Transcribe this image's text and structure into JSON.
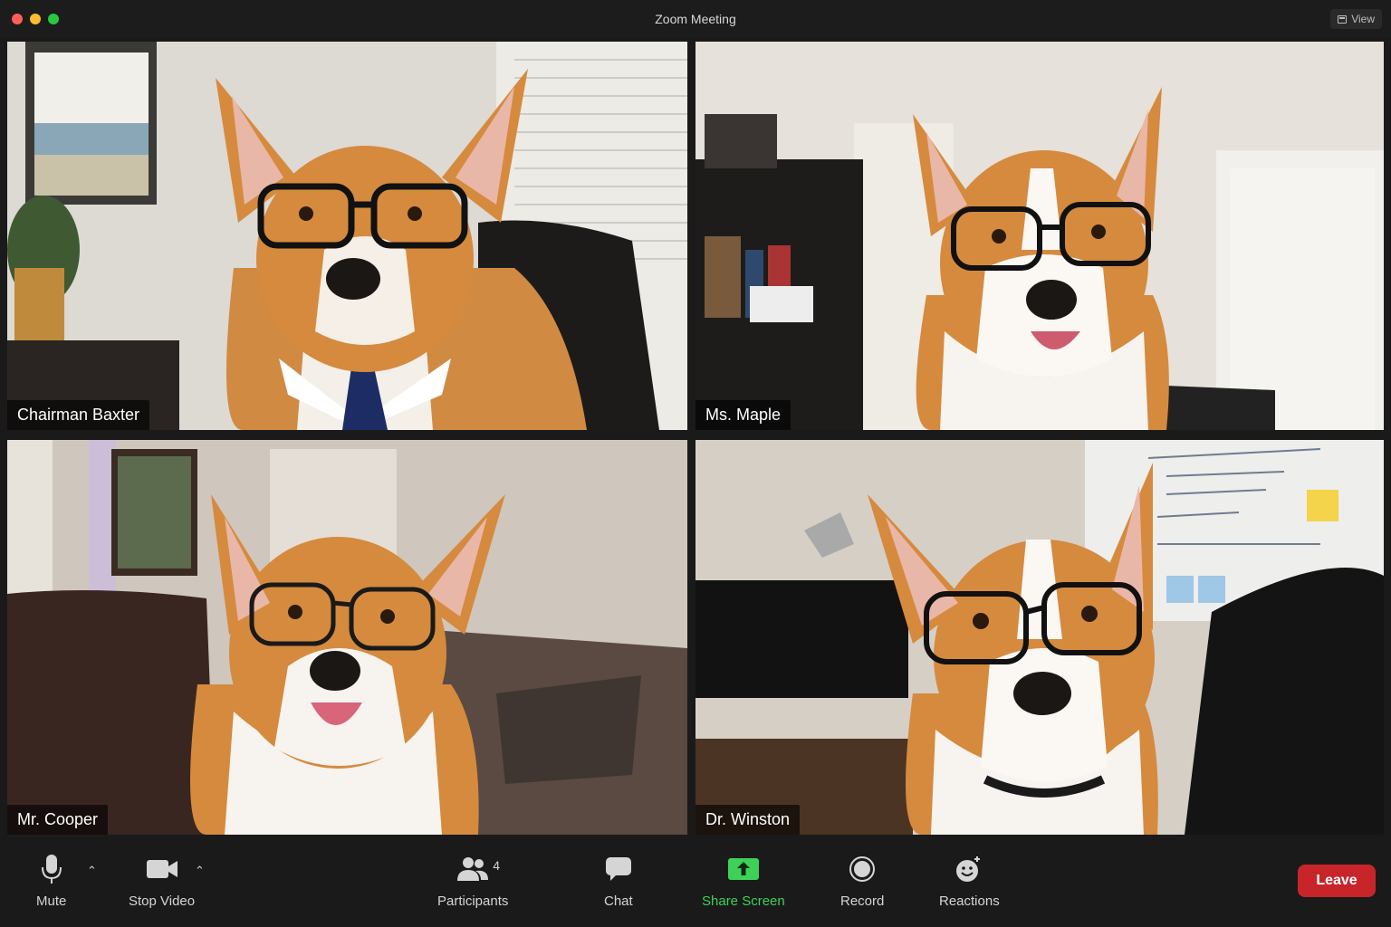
{
  "window": {
    "title": "Zoom Meeting",
    "view_label": "View"
  },
  "participants": [
    {
      "name": "Chairman Baxter"
    },
    {
      "name": "Ms. Maple"
    },
    {
      "name": "Mr. Cooper"
    },
    {
      "name": "Dr. Winston"
    }
  ],
  "toolbar": {
    "mute_label": "Mute",
    "stop_video_label": "Stop Video",
    "participants_label": "Participants",
    "participants_count": "4",
    "chat_label": "Chat",
    "share_screen_label": "Share Screen",
    "record_label": "Record",
    "reactions_label": "Reactions",
    "leave_label": "Leave"
  },
  "colors": {
    "share_green": "#3dd158",
    "leave_red": "#c8252a",
    "corgi_fur": "#d58a3e"
  }
}
